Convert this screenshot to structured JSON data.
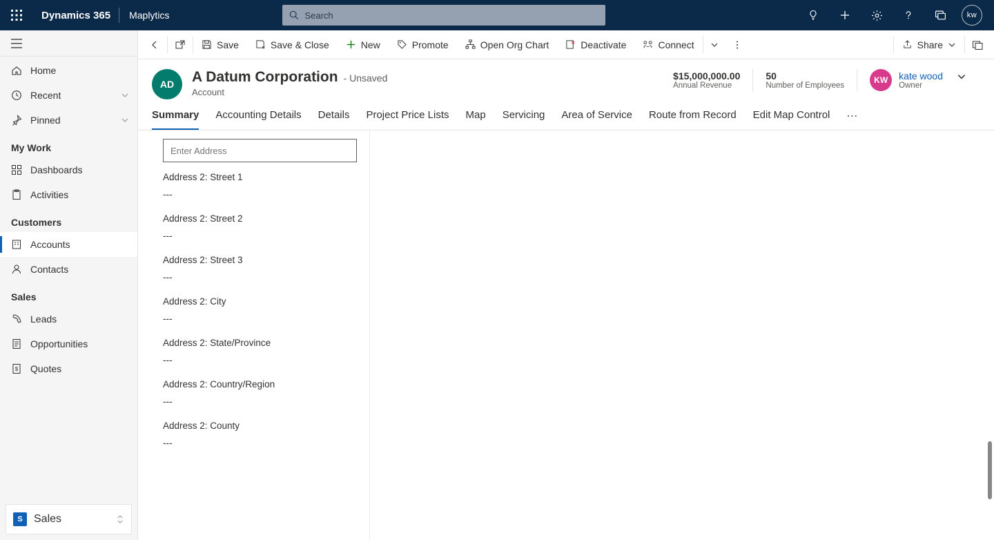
{
  "topbar": {
    "brand": "Dynamics 365",
    "app_name": "Maplytics",
    "search_placeholder": "Search",
    "user_initials": "kw"
  },
  "sidebar": {
    "items": [
      {
        "key": "home",
        "label": "Home"
      },
      {
        "key": "recent",
        "label": "Recent"
      },
      {
        "key": "pinned",
        "label": "Pinned"
      }
    ],
    "sections": [
      {
        "title": "My Work",
        "items": [
          {
            "key": "dashboards",
            "label": "Dashboards"
          },
          {
            "key": "activities",
            "label": "Activities"
          }
        ]
      },
      {
        "title": "Customers",
        "items": [
          {
            "key": "accounts",
            "label": "Accounts"
          },
          {
            "key": "contacts",
            "label": "Contacts"
          }
        ]
      },
      {
        "title": "Sales",
        "items": [
          {
            "key": "leads",
            "label": "Leads"
          },
          {
            "key": "opportunities",
            "label": "Opportunities"
          },
          {
            "key": "quotes",
            "label": "Quotes"
          }
        ]
      }
    ],
    "area_switch": {
      "badge": "S",
      "label": "Sales"
    }
  },
  "commands": {
    "back": "Back",
    "popout": "Pop out",
    "save": "Save",
    "save_close": "Save & Close",
    "new": "New",
    "promote": "Promote",
    "open_org_chart": "Open Org Chart",
    "deactivate": "Deactivate",
    "connect": "Connect",
    "share": "Share"
  },
  "record": {
    "avatar_initials": "AD",
    "title": "A Datum Corporation",
    "unsaved_suffix": "- Unsaved",
    "entity": "Account",
    "meta": [
      {
        "value": "$15,000,000.00",
        "label": "Annual Revenue"
      },
      {
        "value": "50",
        "label": "Number of Employees"
      }
    ],
    "owner": {
      "initials": "KW",
      "name": "kate wood",
      "label": "Owner"
    }
  },
  "tabs": [
    "Summary",
    "Accounting Details",
    "Details",
    "Project Price Lists",
    "Map",
    "Servicing",
    "Area of Service",
    "Route from Record",
    "Edit Map Control"
  ],
  "form": {
    "address_placeholder": "Enter Address",
    "fields": [
      {
        "label": "Address 2: Street 1",
        "value": "---"
      },
      {
        "label": "Address 2: Street 2",
        "value": "---"
      },
      {
        "label": "Address 2: Street 3",
        "value": "---"
      },
      {
        "label": "Address 2: City",
        "value": "---"
      },
      {
        "label": "Address 2: State/Province",
        "value": "---"
      },
      {
        "label": "Address 2: Country/Region",
        "value": "---"
      },
      {
        "label": "Address 2: County",
        "value": "---"
      }
    ]
  }
}
